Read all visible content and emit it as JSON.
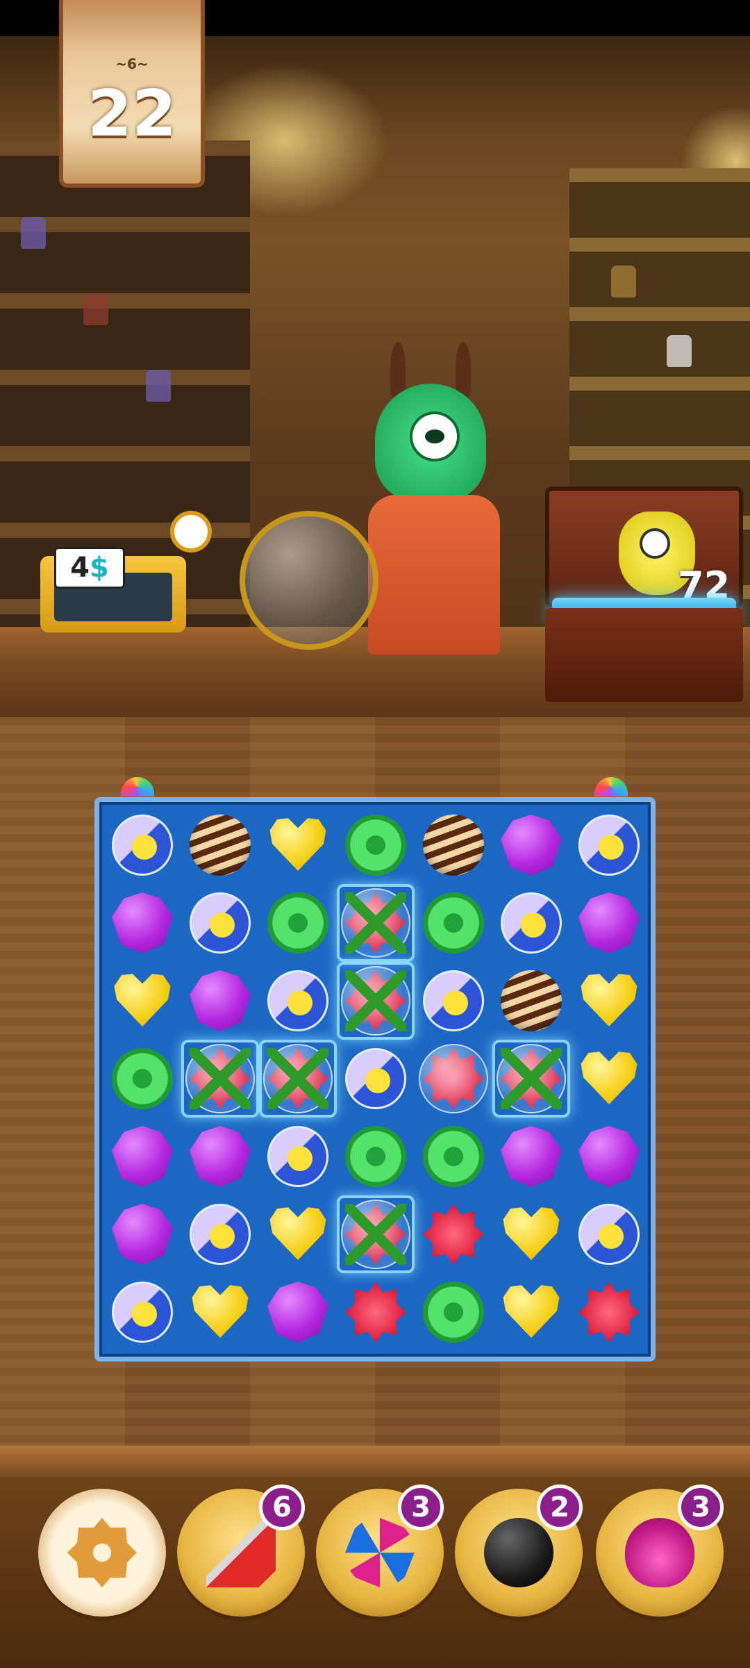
{
  "hud": {
    "moves_label": "~6~",
    "moves_remaining": "22",
    "goal_count": "72",
    "machine_price": "4"
  },
  "board": {
    "columns": 7,
    "rows": 7,
    "grid": [
      [
        "capsule",
        "swirl",
        "heart",
        "ring",
        "swirl",
        "grape",
        "capsule"
      ],
      [
        "grape",
        "capsule",
        "ring",
        "flower-bubble-vine",
        "ring",
        "capsule",
        "grape"
      ],
      [
        "heart",
        "grape",
        "capsule",
        "flower-bubble-vine",
        "capsule",
        "swirl",
        "heart"
      ],
      [
        "ring",
        "flower-bubble-vine",
        "flower-bubble-vine",
        "capsule",
        "flower-bubble",
        "flower-bubble-vine",
        "heart"
      ],
      [
        "grape",
        "grape",
        "capsule",
        "ring",
        "ring",
        "grape",
        "grape"
      ],
      [
        "grape",
        "capsule",
        "heart",
        "flower-bubble-vine",
        "flower",
        "heart",
        "capsule"
      ],
      [
        "capsule",
        "heart",
        "grape",
        "flower",
        "ring",
        "heart",
        "flower"
      ]
    ]
  },
  "boosters": [
    {
      "name": "donut",
      "count": ""
    },
    {
      "name": "dart",
      "count": "6"
    },
    {
      "name": "pinwheel",
      "count": "3"
    },
    {
      "name": "bomb",
      "count": "2"
    },
    {
      "name": "potion",
      "count": "3"
    }
  ],
  "colors": {
    "board_blue": "#1d67c4",
    "badge_purple": "#8a1e8a",
    "wood": "#8a5a2c"
  }
}
